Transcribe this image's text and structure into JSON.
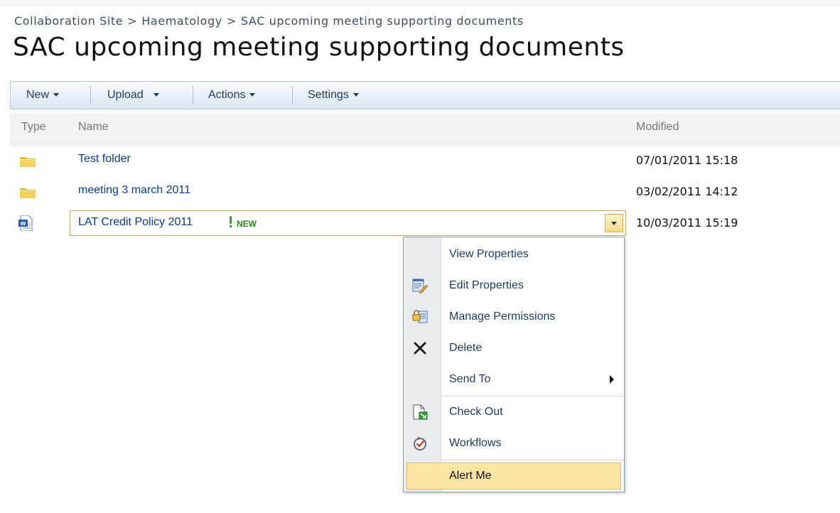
{
  "breadcrumb": {
    "site": "Collaboration Site",
    "parent": "Haematology",
    "current": "SAC upcoming meeting supporting documents",
    "separator": ">"
  },
  "page_title": "SAC upcoming meeting supporting documents",
  "toolbar": {
    "new_label": "New",
    "upload_label": "Upload",
    "actions_label": "Actions",
    "settings_label": "Settings"
  },
  "columns": {
    "type": "Type",
    "name": "Name",
    "modified": "Modified"
  },
  "rows": [
    {
      "icon": "folder-icon",
      "name": "Test folder",
      "modified": "07/01/2011 15:18"
    },
    {
      "icon": "folder-icon",
      "name": "meeting 3 march 2011",
      "modified": "03/02/2011 14:12"
    },
    {
      "icon": "word-document-icon",
      "name": "LAT Credit Policy 2011",
      "new_mark": "!",
      "new_label": "NEW",
      "modified": "10/03/2011 15:19"
    }
  ],
  "context_menu": {
    "items": [
      {
        "label": "View Properties",
        "icon": ""
      },
      {
        "label": "Edit Properties",
        "icon": "edit-properties-icon"
      },
      {
        "label": "Manage Permissions",
        "icon": "manage-permissions-icon"
      },
      {
        "label": "Delete",
        "icon": "delete-icon"
      },
      {
        "label": "Send To",
        "icon": ""
      },
      {
        "label": "Check Out",
        "icon": "check-out-icon"
      },
      {
        "label": "Workflows",
        "icon": "workflows-icon"
      },
      {
        "label": "Alert Me",
        "icon": ""
      }
    ]
  },
  "colors": {
    "link": "#0b3d80",
    "toolbar_text": "#1d3a5f",
    "highlight": "#fbe5a5",
    "new_green": "#2c8a1d"
  }
}
